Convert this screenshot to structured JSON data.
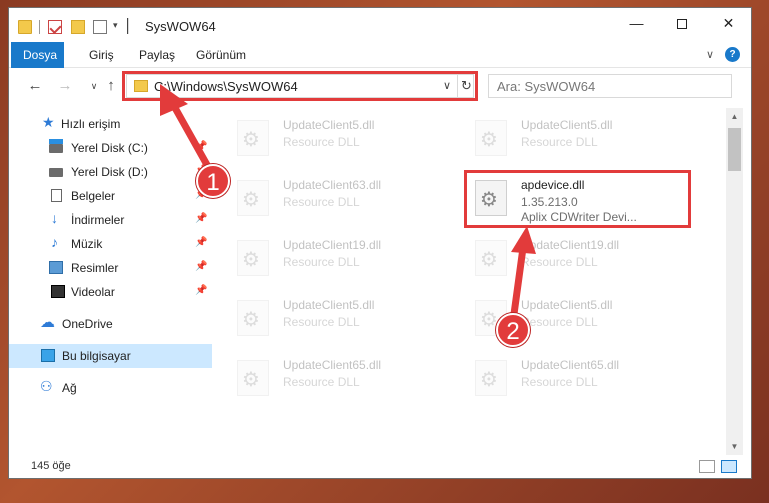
{
  "window": {
    "title": "SysWOW64",
    "minimize_glyph": "—",
    "close_glyph": "✕"
  },
  "ribbon": {
    "tabs": [
      {
        "label": "Dosya",
        "active": true
      },
      {
        "label": "Giriş"
      },
      {
        "label": "Paylaş"
      },
      {
        "label": "Görünüm"
      }
    ],
    "chevron_glyph": "∨",
    "help_glyph": "?"
  },
  "navigation": {
    "back_glyph": "←",
    "forward_glyph": "→",
    "recent_glyph": "∨",
    "up_glyph": "↑"
  },
  "address": {
    "path": "C:\\Windows\\SysWOW64",
    "chevron_glyph": "∨",
    "refresh_glyph": "↻"
  },
  "search": {
    "placeholder": "Ara: SysWOW64"
  },
  "sidebar": {
    "pin_glyph": "📌",
    "items": [
      {
        "label": "Hızlı erişim",
        "icon": "star-icon",
        "glyph": "★"
      },
      {
        "label": "Yerel Disk (C:)",
        "icon": "drive-c-icon",
        "pinned": true
      },
      {
        "label": "Yerel Disk (D:)",
        "icon": "drive-d-icon",
        "pinned": true
      },
      {
        "label": "Belgeler",
        "icon": "documents-icon",
        "pinned": true
      },
      {
        "label": "İndirmeler",
        "icon": "downloads-icon",
        "glyph": "↓",
        "pinned": true
      },
      {
        "label": "Müzik",
        "icon": "music-icon",
        "glyph": "♪",
        "pinned": true
      },
      {
        "label": "Resimler",
        "icon": "pictures-icon",
        "pinned": true
      },
      {
        "label": "Videolar",
        "icon": "videos-icon",
        "pinned": true
      },
      {
        "label": "OneDrive",
        "icon": "onedrive-icon",
        "glyph": "☁"
      },
      {
        "label": "Bu bilgisayar",
        "icon": "this-pc-icon",
        "selected": true
      },
      {
        "label": "Ağ",
        "icon": "network-icon",
        "glyph": "⚇"
      }
    ]
  },
  "files": [
    {
      "name": "UpdateClient5.dll",
      "type": "Resource DLL"
    },
    {
      "name": "UpdateClient5.dll",
      "type": "Resource DLL"
    },
    {
      "name": "UpdateClient63.dll",
      "type": "Resource DLL"
    },
    {
      "name": "apdevice.dll",
      "version": "1.35.213.0",
      "description": "Aplix CDWriter Devi...",
      "focused": true
    },
    {
      "name": "UpdateClient19.dll",
      "type": "Resource DLL"
    },
    {
      "name": "UpdateClient19.dll",
      "type": "Resource DLL"
    },
    {
      "name": "UpdateClient5.dll",
      "type": "Resource DLL"
    },
    {
      "name": "UpdateClient5.dll",
      "type": "Resource DLL"
    },
    {
      "name": "UpdateClient65.dll",
      "type": "Resource DLL"
    },
    {
      "name": "UpdateClient65.dll",
      "type": "Resource DLL"
    }
  ],
  "scrollbar": {
    "up_glyph": "▲",
    "down_glyph": "▼"
  },
  "status": {
    "item_count": "145 öğe"
  },
  "annotations": {
    "step1": "1",
    "step2": "2",
    "color": "#e23b3b"
  },
  "colors": {
    "accent": "#1979ca",
    "selected_bg": "#cce8ff",
    "highlight": "#e23b3b"
  }
}
